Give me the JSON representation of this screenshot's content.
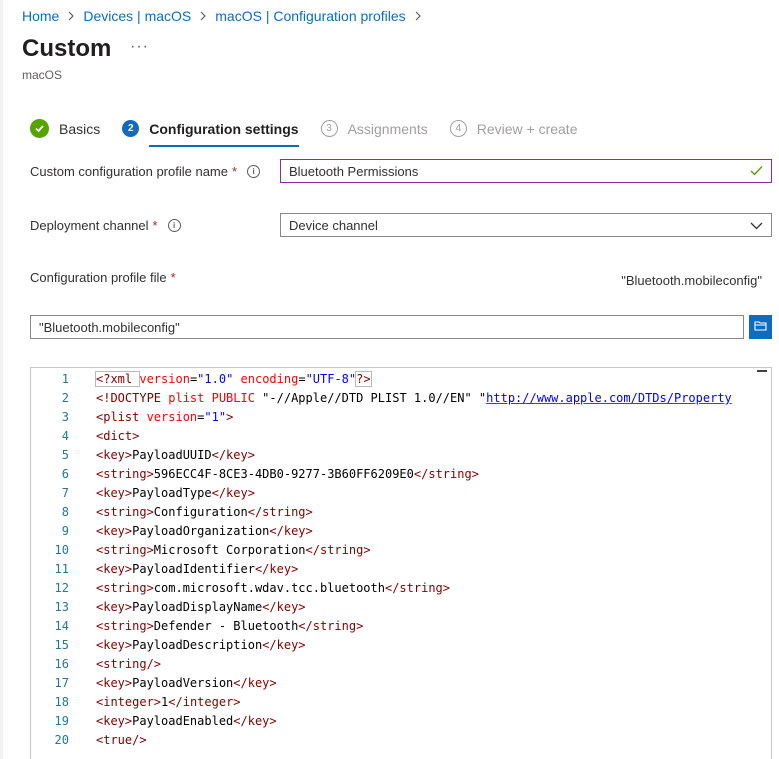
{
  "breadcrumb": [
    "Home",
    "Devices | macOS",
    "macOS | Configuration profiles"
  ],
  "header": {
    "title": "Custom",
    "more": "···",
    "subtitle": "macOS"
  },
  "steps": [
    {
      "number": "✓",
      "label": "Basics",
      "state": "done"
    },
    {
      "number": "2",
      "label": "Configuration settings",
      "state": "current"
    },
    {
      "number": "3",
      "label": "Assignments",
      "state": "future"
    },
    {
      "number": "4",
      "label": "Review + create",
      "state": "future"
    }
  ],
  "form": {
    "profile_name_label": "Custom configuration profile name",
    "profile_name_value": "Bluetooth Permissions",
    "deployment_label": "Deployment channel",
    "deployment_value": "Device channel",
    "file_label": "Configuration profile file",
    "file_name_display": "\"Bluetooth.mobileconfig\"",
    "file_input_value": "\"Bluetooth.mobileconfig\"",
    "required_mark": "*",
    "info_glyph": "i"
  },
  "colors": {
    "accent": "#0f6cbd",
    "success": "#57a300",
    "focus_border": "#8a2da5",
    "required": "#a4262c"
  },
  "editor": {
    "lines": [
      {
        "n": "1",
        "tokens": [
          [
            "tag",
            "<?xml "
          ],
          [
            "attr",
            "version"
          ],
          [
            "txt",
            "="
          ],
          [
            "val",
            "\"1.0\""
          ],
          [
            "txt",
            " "
          ],
          [
            "attr",
            "encoding"
          ],
          [
            "txt",
            "="
          ],
          [
            "val",
            "\"UTF-8\""
          ],
          [
            "tag",
            "?>"
          ]
        ]
      },
      {
        "n": "2",
        "tokens": [
          [
            "tag",
            "<!DOCTYPE "
          ],
          [
            "attr",
            "plist PUBLIC "
          ],
          [
            "txt",
            "\"-//Apple//DTD PLIST 1.0//EN\" \""
          ],
          [
            "url",
            "http://www.apple.com/DTDs/Property"
          ]
        ]
      },
      {
        "n": "3",
        "tokens": [
          [
            "tag",
            "<plist "
          ],
          [
            "attr",
            "version"
          ],
          [
            "txt",
            "="
          ],
          [
            "val",
            "\"1\""
          ],
          [
            "tag",
            ">"
          ]
        ]
      },
      {
        "n": "4",
        "tokens": [
          [
            "tag",
            "<dict>"
          ]
        ]
      },
      {
        "n": "5",
        "tokens": [
          [
            "tag",
            "<key>"
          ],
          [
            "txt",
            "PayloadUUID"
          ],
          [
            "tag",
            "</key>"
          ]
        ]
      },
      {
        "n": "6",
        "tokens": [
          [
            "tag",
            "<string>"
          ],
          [
            "txt",
            "596ECC4F-8CE3-4DB0-9277-3B60FF6209E0"
          ],
          [
            "tag",
            "</string>"
          ]
        ]
      },
      {
        "n": "7",
        "tokens": [
          [
            "tag",
            "<key>"
          ],
          [
            "txt",
            "PayloadType"
          ],
          [
            "tag",
            "</key>"
          ]
        ]
      },
      {
        "n": "8",
        "tokens": [
          [
            "tag",
            "<string>"
          ],
          [
            "txt",
            "Configuration"
          ],
          [
            "tag",
            "</string>"
          ]
        ]
      },
      {
        "n": "9",
        "tokens": [
          [
            "tag",
            "<key>"
          ],
          [
            "txt",
            "PayloadOrganization"
          ],
          [
            "tag",
            "</key>"
          ]
        ]
      },
      {
        "n": "10",
        "tokens": [
          [
            "tag",
            "<string>"
          ],
          [
            "txt",
            "Microsoft Corporation"
          ],
          [
            "tag",
            "</string>"
          ]
        ]
      },
      {
        "n": "11",
        "tokens": [
          [
            "tag",
            "<key>"
          ],
          [
            "txt",
            "PayloadIdentifier"
          ],
          [
            "tag",
            "</key>"
          ]
        ]
      },
      {
        "n": "12",
        "tokens": [
          [
            "tag",
            "<string>"
          ],
          [
            "txt",
            "com.microsoft.wdav.tcc.bluetooth"
          ],
          [
            "tag",
            "</string>"
          ]
        ]
      },
      {
        "n": "13",
        "tokens": [
          [
            "tag",
            "<key>"
          ],
          [
            "txt",
            "PayloadDisplayName"
          ],
          [
            "tag",
            "</key>"
          ]
        ]
      },
      {
        "n": "14",
        "tokens": [
          [
            "tag",
            "<string>"
          ],
          [
            "txt",
            "Defender - Bluetooth"
          ],
          [
            "tag",
            "</string>"
          ]
        ]
      },
      {
        "n": "15",
        "tokens": [
          [
            "tag",
            "<key>"
          ],
          [
            "txt",
            "PayloadDescription"
          ],
          [
            "tag",
            "</key>"
          ]
        ]
      },
      {
        "n": "16",
        "tokens": [
          [
            "tag",
            "<string/>"
          ]
        ]
      },
      {
        "n": "17",
        "tokens": [
          [
            "tag",
            "<key>"
          ],
          [
            "txt",
            "PayloadVersion"
          ],
          [
            "tag",
            "</key>"
          ]
        ]
      },
      {
        "n": "18",
        "tokens": [
          [
            "tag",
            "<integer>"
          ],
          [
            "txt",
            "1"
          ],
          [
            "tag",
            "</integer>"
          ]
        ]
      },
      {
        "n": "19",
        "tokens": [
          [
            "tag",
            "<key>"
          ],
          [
            "txt",
            "PayloadEnabled"
          ],
          [
            "tag",
            "</key>"
          ]
        ]
      },
      {
        "n": "20",
        "tokens": [
          [
            "tag",
            "<true/>"
          ]
        ]
      }
    ]
  }
}
